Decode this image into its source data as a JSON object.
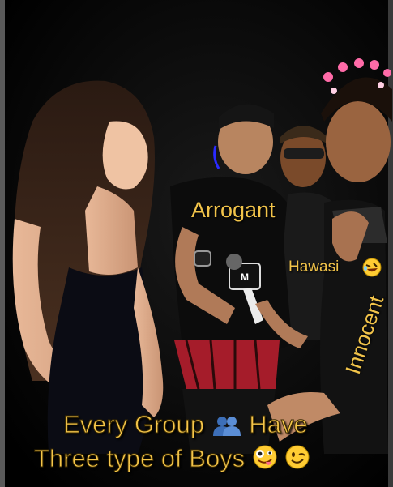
{
  "labels": {
    "arrogant": "Arrogant",
    "hawasi": "Hawasi",
    "innocent": "Innocent"
  },
  "caption": {
    "line1": "Every Group",
    "line1_end": "Have",
    "line2": "Three type of Boys"
  },
  "icons": {
    "group": "busts-in-silhouette-icon",
    "laughing": "rolling-on-floor-laughing-emoji",
    "zany": "zany-face-emoji",
    "wink": "winking-face-emoji"
  },
  "colors": {
    "caption_text": "#f5c64b",
    "label_text": "#f2c44a",
    "background": "#000000"
  }
}
